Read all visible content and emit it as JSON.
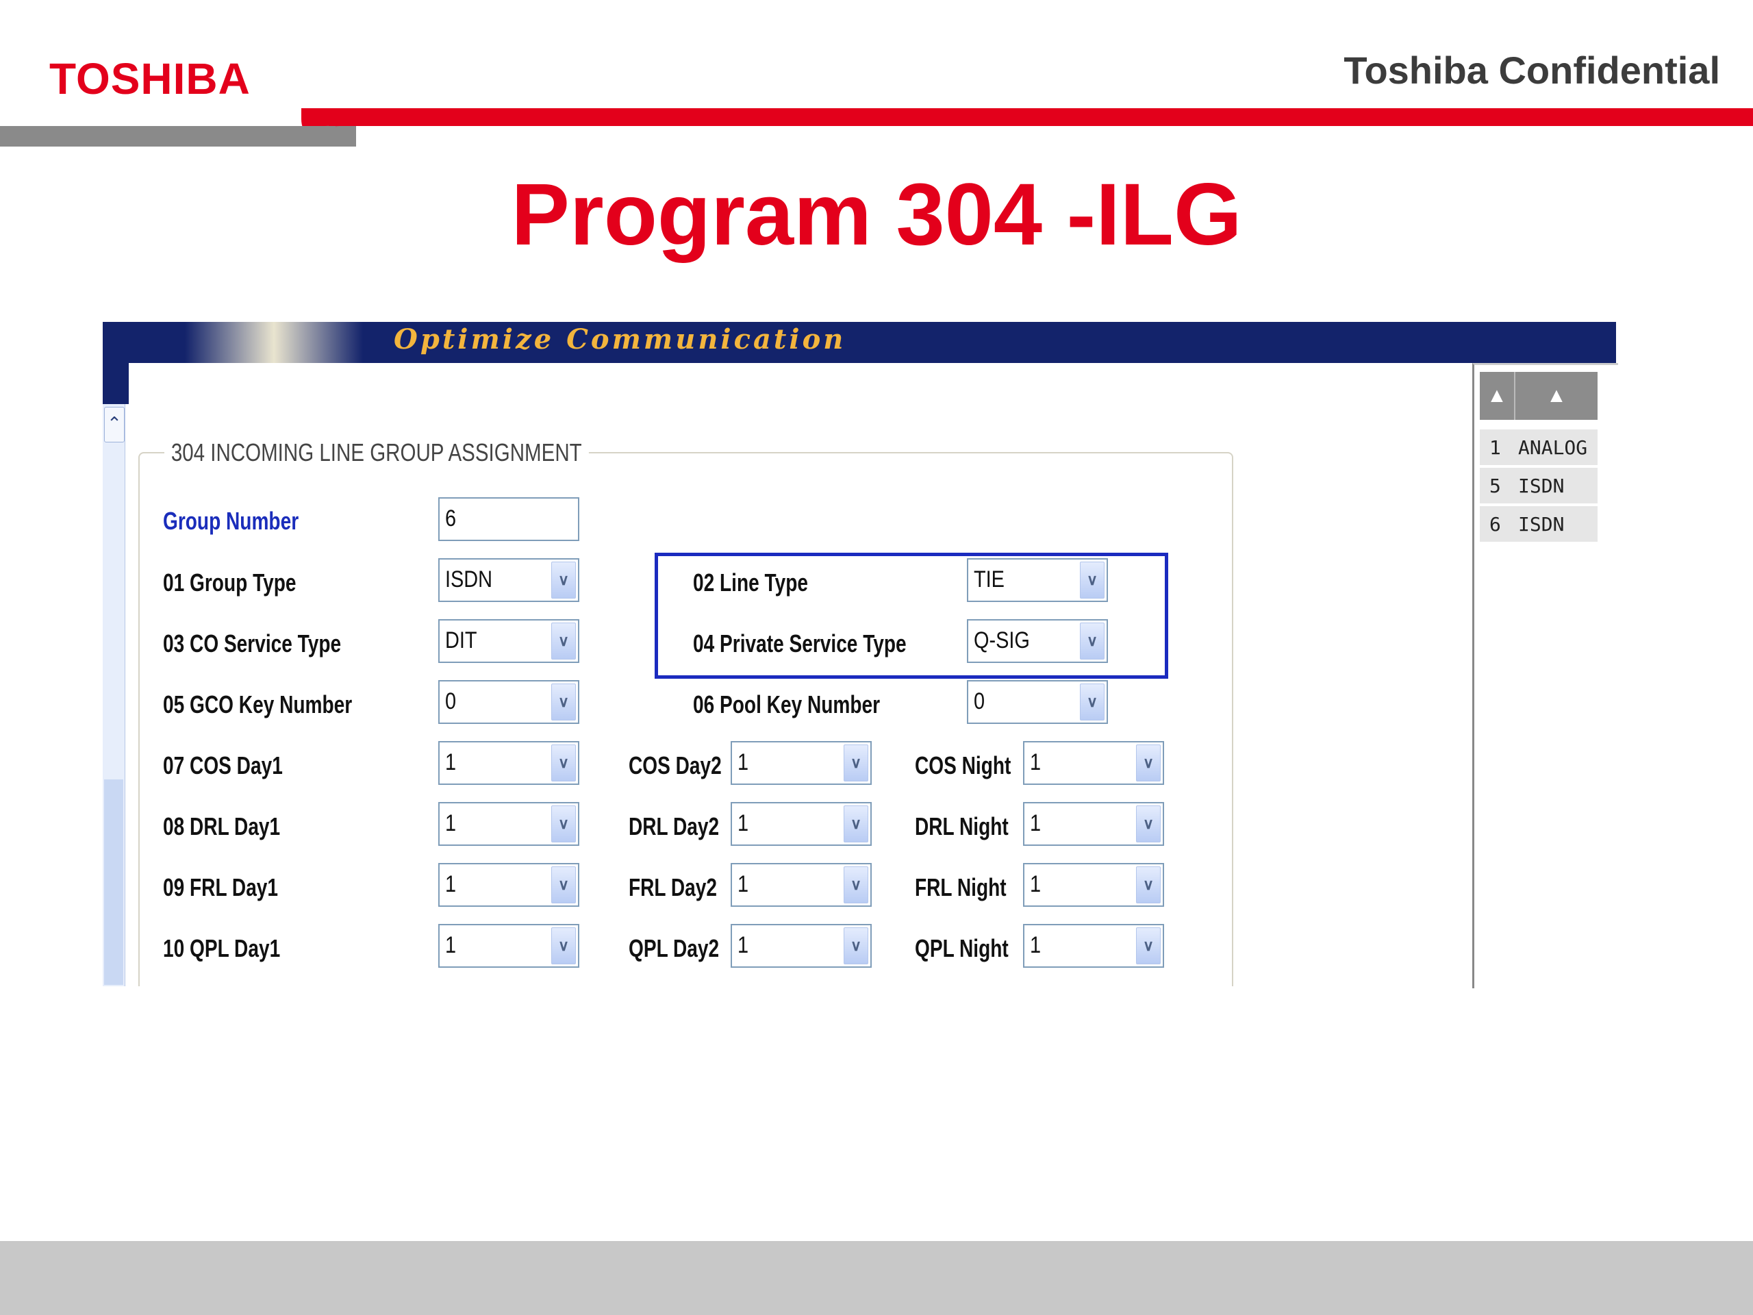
{
  "slide": {
    "logo": "TOSHIBA",
    "confidential": "Toshiba Confidential",
    "title": "Program 304 -ILG"
  },
  "app": {
    "banner_text": "Optimize Communication",
    "section_title": "304 INCOMING LINE GROUP ASSIGNMENT",
    "group_number": {
      "label": "Group Number",
      "value": "6"
    },
    "fields": {
      "group_type": {
        "label": "01 Group Type",
        "value": "ISDN"
      },
      "line_type": {
        "label": "02 Line Type",
        "value": "TIE"
      },
      "co_service_type": {
        "label": "03 CO Service Type",
        "value": "DIT"
      },
      "private_service_type": {
        "label": "04 Private Service Type",
        "value": "Q-SIG"
      },
      "gco_key_number": {
        "label": "05 GCO Key Number",
        "value": "0"
      },
      "pool_key_number": {
        "label": "06 Pool Key Number",
        "value": "0"
      }
    },
    "rows": [
      {
        "l1": "07 COS Day1",
        "v1": "1",
        "l2": "COS Day2",
        "v2": "1",
        "l3": "COS Night",
        "v3": "1"
      },
      {
        "l1": "08 DRL Day1",
        "v1": "1",
        "l2": "DRL Day2",
        "v2": "1",
        "l3": "DRL Night",
        "v3": "1"
      },
      {
        "l1": "09 FRL Day1",
        "v1": "1",
        "l2": "FRL Day2",
        "v2": "1",
        "l3": "FRL Night",
        "v3": "1"
      },
      {
        "l1": "10 QPL Day1",
        "v1": "1",
        "l2": "QPL Day2",
        "v2": "1",
        "l3": "QPL Night",
        "v3": "1"
      }
    ],
    "dropdown_arrow": "chevron-down-icon"
  },
  "group_list": {
    "items": [
      {
        "num": "1",
        "type": "ANALOG"
      },
      {
        "num": "5",
        "type": "ISDN"
      },
      {
        "num": "6",
        "type": "ISDN"
      }
    ]
  },
  "colors": {
    "brand_red": "#e3001b",
    "banner_navy": "#13236b",
    "highlight_blue": "#1b2bbf",
    "label_blue": "#1a2dbb"
  }
}
